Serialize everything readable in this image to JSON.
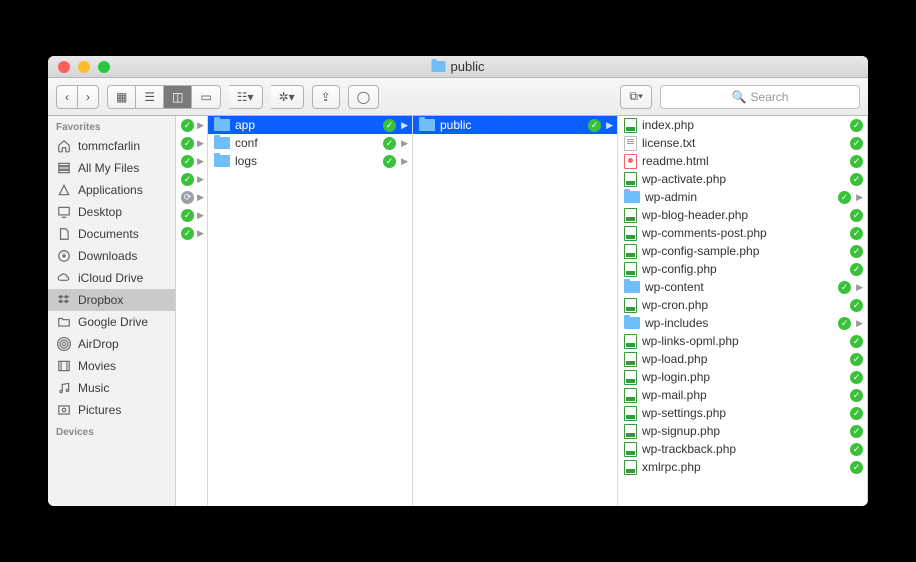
{
  "window": {
    "title": "public"
  },
  "toolbar": {
    "search_placeholder": "Search",
    "view_modes": [
      "icon",
      "list",
      "column",
      "gallery"
    ],
    "active_view": "column"
  },
  "sidebar": {
    "sections": [
      {
        "header": "Favorites",
        "items": [
          {
            "label": "tommcfarlin",
            "icon": "home",
            "selected": false
          },
          {
            "label": "All My Files",
            "icon": "all-files",
            "selected": false
          },
          {
            "label": "Applications",
            "icon": "apps",
            "selected": false
          },
          {
            "label": "Desktop",
            "icon": "desktop",
            "selected": false
          },
          {
            "label": "Documents",
            "icon": "documents",
            "selected": false
          },
          {
            "label": "Downloads",
            "icon": "downloads",
            "selected": false
          },
          {
            "label": "iCloud Drive",
            "icon": "cloud",
            "selected": false
          },
          {
            "label": "Dropbox",
            "icon": "dropbox",
            "selected": true
          },
          {
            "label": "Google Drive",
            "icon": "folder",
            "selected": false
          },
          {
            "label": "AirDrop",
            "icon": "airdrop",
            "selected": false
          },
          {
            "label": "Movies",
            "icon": "movies",
            "selected": false
          },
          {
            "label": "Music",
            "icon": "music",
            "selected": false
          },
          {
            "label": "Pictures",
            "icon": "pictures",
            "selected": false
          }
        ]
      },
      {
        "header": "Devices",
        "items": []
      }
    ]
  },
  "columns": [
    {
      "partial_items": [
        {
          "synced": true,
          "arrow": true
        },
        {
          "synced": true,
          "arrow": true
        },
        {
          "synced": true,
          "arrow": true
        },
        {
          "synced": true,
          "arrow": true
        },
        {
          "synced": false,
          "arrow": true
        },
        {
          "synced": true,
          "arrow": true
        },
        {
          "synced": true,
          "arrow": true
        }
      ]
    },
    {
      "items": [
        {
          "name": "app",
          "type": "folder",
          "synced": true,
          "selected": true,
          "arrow": true
        },
        {
          "name": "conf",
          "type": "folder",
          "synced": true,
          "selected": false,
          "arrow": true
        },
        {
          "name": "logs",
          "type": "folder",
          "synced": true,
          "selected": false,
          "arrow": true
        }
      ]
    },
    {
      "items": [
        {
          "name": "public",
          "type": "folder",
          "synced": true,
          "selected": true,
          "arrow": true
        }
      ]
    },
    {
      "items": [
        {
          "name": "index.php",
          "type": "php",
          "synced": true
        },
        {
          "name": "license.txt",
          "type": "txt",
          "synced": true
        },
        {
          "name": "readme.html",
          "type": "html",
          "synced": true
        },
        {
          "name": "wp-activate.php",
          "type": "php",
          "synced": true
        },
        {
          "name": "wp-admin",
          "type": "folder",
          "synced": true,
          "arrow": true
        },
        {
          "name": "wp-blog-header.php",
          "type": "php",
          "synced": true
        },
        {
          "name": "wp-comments-post.php",
          "type": "php",
          "synced": true
        },
        {
          "name": "wp-config-sample.php",
          "type": "php",
          "synced": true
        },
        {
          "name": "wp-config.php",
          "type": "php",
          "synced": true
        },
        {
          "name": "wp-content",
          "type": "folder",
          "synced": true,
          "arrow": true
        },
        {
          "name": "wp-cron.php",
          "type": "php",
          "synced": true
        },
        {
          "name": "wp-includes",
          "type": "folder",
          "synced": true,
          "arrow": true
        },
        {
          "name": "wp-links-opml.php",
          "type": "php",
          "synced": true
        },
        {
          "name": "wp-load.php",
          "type": "php",
          "synced": true
        },
        {
          "name": "wp-login.php",
          "type": "php",
          "synced": true
        },
        {
          "name": "wp-mail.php",
          "type": "php",
          "synced": true
        },
        {
          "name": "wp-settings.php",
          "type": "php",
          "synced": true
        },
        {
          "name": "wp-signup.php",
          "type": "php",
          "synced": true
        },
        {
          "name": "wp-trackback.php",
          "type": "php",
          "synced": true
        },
        {
          "name": "xmlrpc.php",
          "type": "php",
          "synced": true
        }
      ]
    }
  ]
}
